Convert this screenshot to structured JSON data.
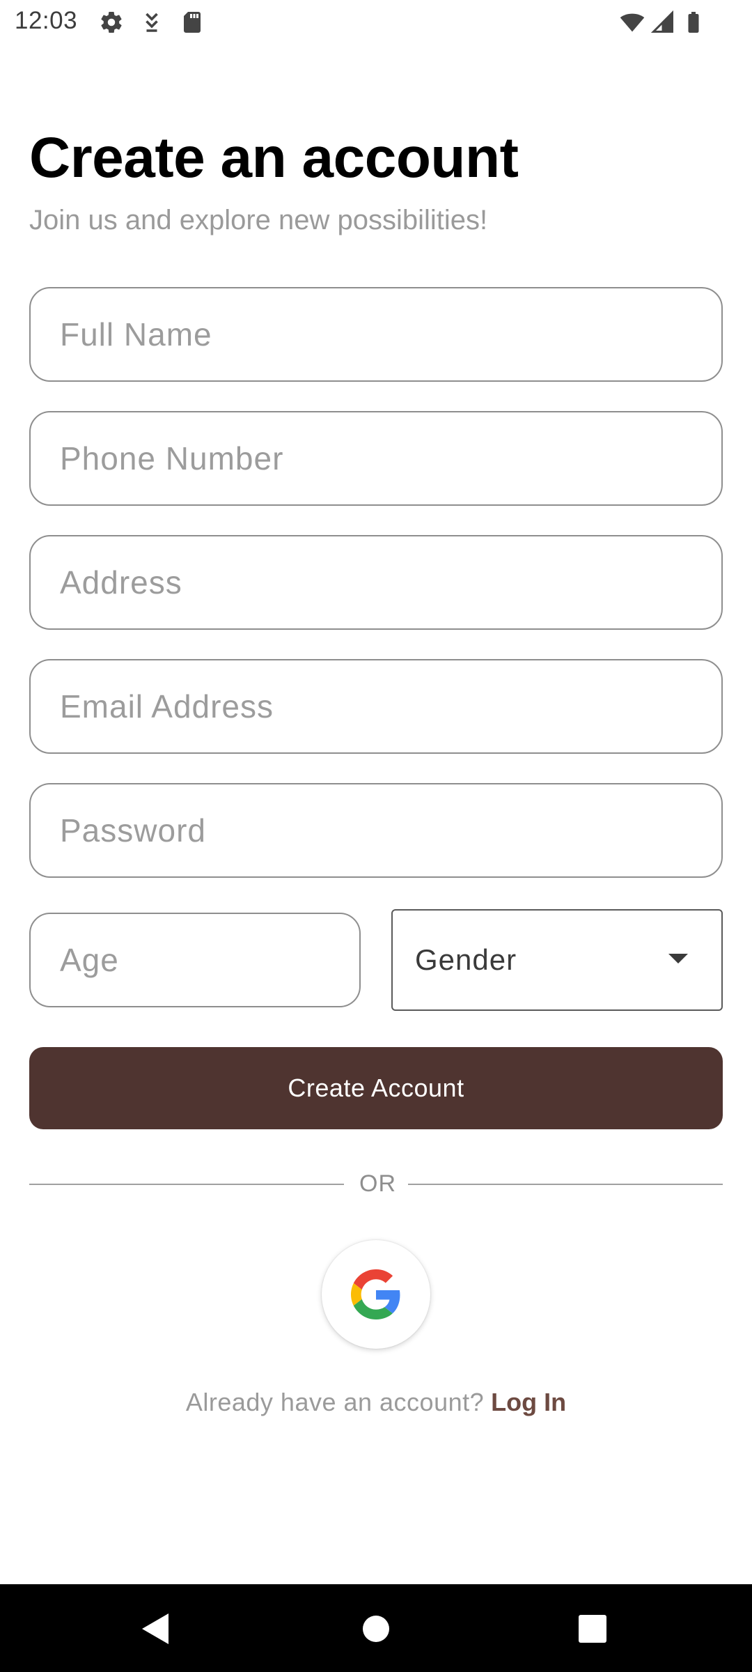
{
  "status_bar": {
    "time": "12:03",
    "left_icons": [
      "gear-icon",
      "download-icon",
      "sd-card-icon"
    ],
    "right_icons": [
      "wifi-icon",
      "signal-icon",
      "battery-icon"
    ]
  },
  "header": {
    "title": "Create an account",
    "subtitle": "Join us and explore new possibilities!"
  },
  "form": {
    "full_name": {
      "placeholder": "Full Name",
      "value": ""
    },
    "phone": {
      "placeholder": "Phone Number",
      "value": ""
    },
    "address": {
      "placeholder": "Address",
      "value": ""
    },
    "email": {
      "placeholder": "Email Address",
      "value": ""
    },
    "password": {
      "placeholder": "Password",
      "value": ""
    },
    "age": {
      "placeholder": "Age",
      "value": ""
    },
    "gender": {
      "label": "Gender"
    },
    "submit_label": "Create Account"
  },
  "divider": {
    "text": "OR"
  },
  "social": {
    "google_icon": "google-icon"
  },
  "footer": {
    "prompt": "Already have an account?",
    "link": "Log In"
  },
  "colors": {
    "primary": "#4f3430",
    "link": "#6d4a41",
    "placeholder": "#9c9c9c",
    "border": "#8e8e8e"
  }
}
